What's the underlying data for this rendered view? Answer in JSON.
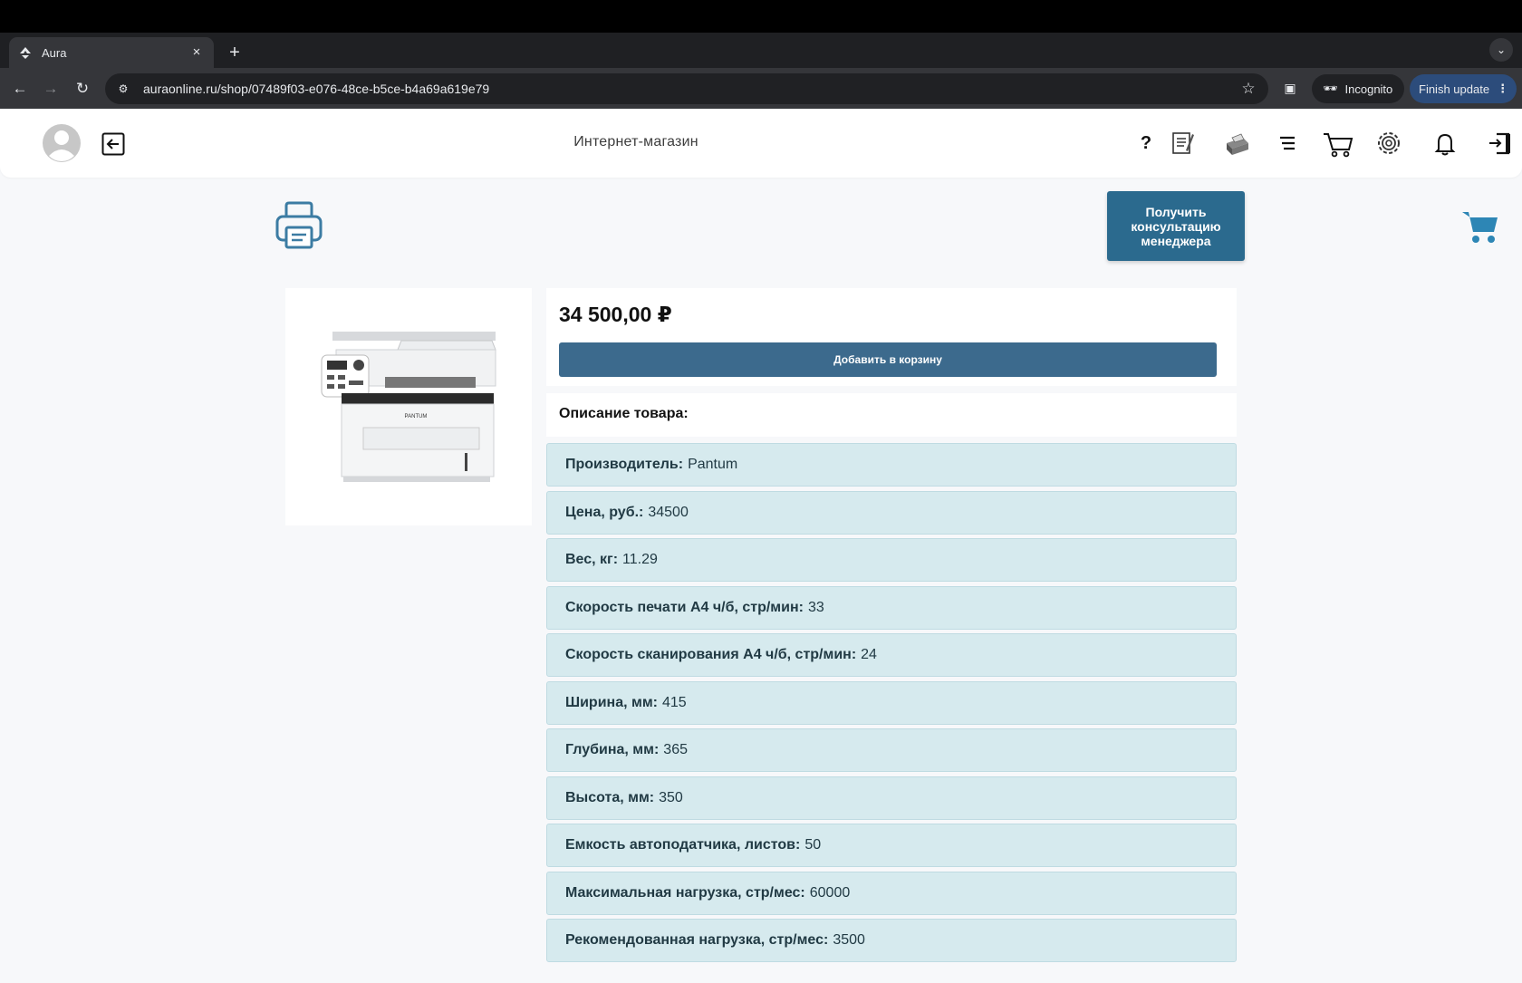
{
  "browser": {
    "tab_title": "Aura",
    "new_tab": "+",
    "tab_close": "×",
    "url": "auraonline.ru/shop/07489f03-e076-48ce-b5ce-b4a69a619e79",
    "incognito_label": "Incognito",
    "finish_update_label": "Finish update"
  },
  "header": {
    "title": "Интернет-магазин",
    "help_label": "?"
  },
  "consult_button": "Получить консультацию менеджера",
  "product": {
    "price": "34 500,00 ₽",
    "add_to_cart_label": "Добавить в корзину",
    "description_title": "Описание товара:",
    "specs": [
      {
        "label": "Производитель:",
        "value": "Pantum"
      },
      {
        "label": "Цена, руб.:",
        "value": "34500"
      },
      {
        "label": "Вес, кг:",
        "value": "11.29"
      },
      {
        "label": "Скорость печати А4 ч/б, стр/мин:",
        "value": "33"
      },
      {
        "label": "Скорость сканирования А4 ч/б, стр/мин:",
        "value": "24"
      },
      {
        "label": "Ширина, мм:",
        "value": "415"
      },
      {
        "label": "Глубина, мм:",
        "value": "365"
      },
      {
        "label": "Высота, мм:",
        "value": "350"
      },
      {
        "label": "Емкость автоподатчика, листов:",
        "value": "50"
      },
      {
        "label": "Максимальная нагрузка, стр/мес:",
        "value": "60000"
      },
      {
        "label": "Рекомендованная нагрузка, стр/мес:",
        "value": "3500"
      }
    ],
    "image_brand_text": "PANTUM"
  },
  "colors": {
    "accent": "#2b6a8e",
    "button": "#3c6a8d",
    "spec_bg": "#d6eaee",
    "page_bg": "#f7f8fa"
  }
}
